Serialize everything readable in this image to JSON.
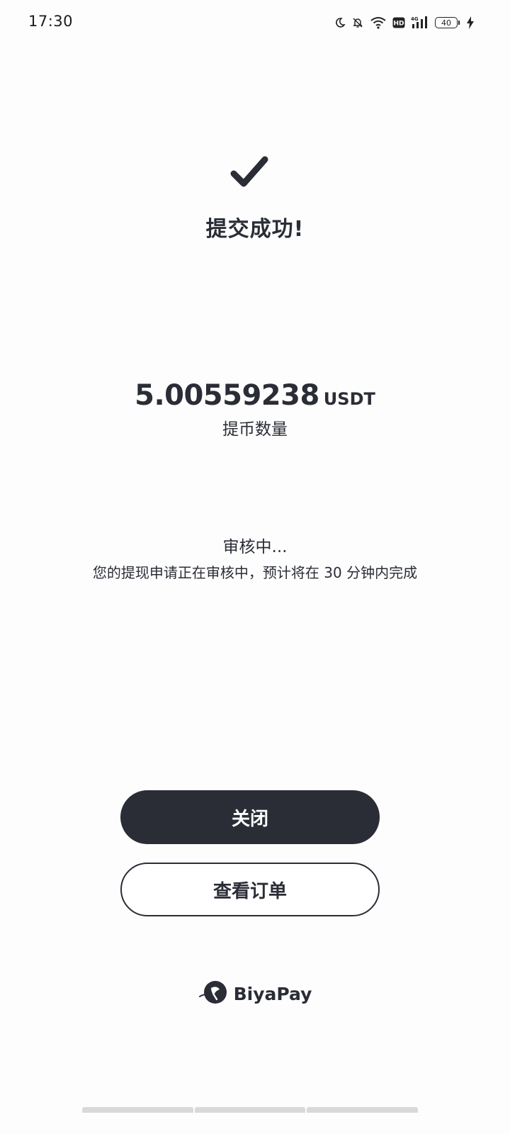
{
  "status_bar": {
    "time": "17:30",
    "battery": "40",
    "icons": [
      "moon-icon",
      "bell-off-icon",
      "wifi-icon",
      "hd-icon",
      "signal-4g-icon",
      "battery-icon",
      "charging-icon"
    ]
  },
  "result": {
    "title": "提交成功!",
    "icon": "check-icon"
  },
  "withdrawal": {
    "amount": "5.00559238",
    "unit": "USDT",
    "label": "提币数量"
  },
  "review": {
    "status": "审核中...",
    "description": "您的提现申请正在审核中，预计将在 30 分钟内完成"
  },
  "actions": {
    "close_label": "关闭",
    "view_orders_label": "查看订单"
  },
  "brand": {
    "name": "BiyaPay",
    "icon": "biyapay-logo-icon"
  },
  "colors": {
    "primary": "#2a2d36",
    "background": "#fdfdfd",
    "button_text": "#ffffff"
  }
}
